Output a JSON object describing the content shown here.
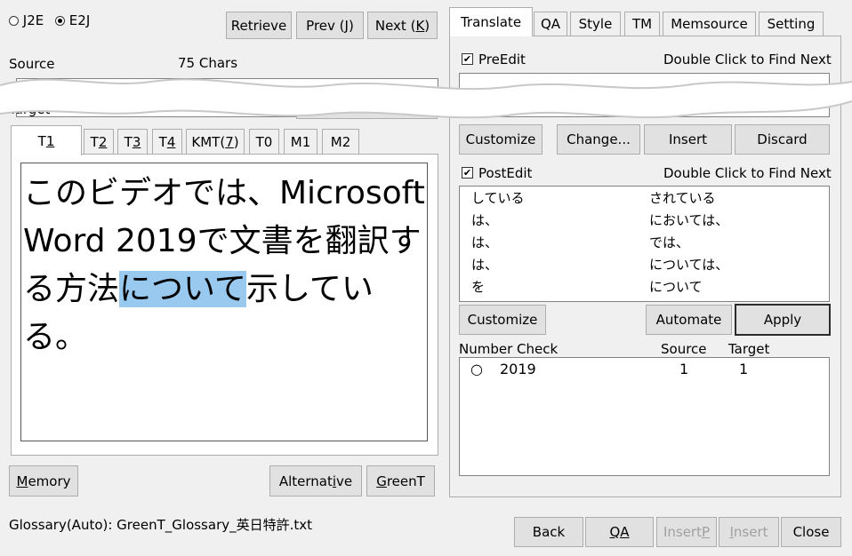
{
  "mode": {
    "options": [
      "J2E",
      "E2J"
    ],
    "selected": "E2J"
  },
  "nav_buttons": {
    "retrieve": "Retrieve",
    "prev_text": "Prev (",
    "prev_key": "J",
    "next_text": "Next (",
    "next_key": "K",
    "close_paren": ")"
  },
  "source": {
    "label": "Source",
    "chars": "75 Chars"
  },
  "target": {
    "label": "Target"
  },
  "left_tabs": [
    {
      "pre": "T",
      "key": "1",
      "post": ""
    },
    {
      "pre": "T",
      "key": "2",
      "post": ""
    },
    {
      "pre": "T",
      "key": "3",
      "post": ""
    },
    {
      "pre": "T",
      "key": "4",
      "post": ""
    },
    {
      "pre": "KMT(",
      "key": "7",
      "post": ")"
    },
    {
      "pre": "T0",
      "key": "",
      "post": ""
    },
    {
      "pre": "M1",
      "key": "",
      "post": ""
    },
    {
      "pre": "M2",
      "key": "",
      "post": ""
    }
  ],
  "editor": {
    "line1": "このビデオでは、Microsoft",
    "line2": "Word 2019で文書を翻訳す",
    "line3_before": "る方法",
    "line3_highlight": "について",
    "line3_after": "示している。"
  },
  "bottom_left": {
    "memory_key": "M",
    "memory_rest": "emory",
    "alt_pre": "Alternat",
    "alt_key": "i",
    "alt_post": "ve",
    "greent_key": "G",
    "greent_rest": "reenT"
  },
  "right_tabs": [
    "Translate",
    "QA",
    "Style",
    "TM",
    "Memsource",
    "Setting"
  ],
  "preedit": {
    "label": "PreEdit",
    "checked": "✔",
    "hint": "Double Click to Find Next"
  },
  "preedit_buttons": {
    "customize": "Customize",
    "change": "Change...",
    "insert": "Insert",
    "discard": "Discard"
  },
  "postedit": {
    "label": "PostEdit",
    "checked": "✔",
    "hint": "Double Click to Find Next",
    "rows": [
      {
        "from": "している",
        "to": "されている"
      },
      {
        "from": "は、",
        "to": "においては、"
      },
      {
        "from": "は、",
        "to": "では、"
      },
      {
        "from": "は、",
        "to": "については、"
      },
      {
        "from": "を",
        "to": "について"
      }
    ]
  },
  "postedit_buttons": {
    "customize": "Customize",
    "automate": "Automate",
    "apply": "Apply"
  },
  "number_check": {
    "label": "Number Check",
    "col_source": "Source",
    "col_target": "Target",
    "rows": [
      {
        "mark": "○",
        "number": "2019",
        "source": "1",
        "target": "1"
      }
    ]
  },
  "status": {
    "glossary": "Glossary(Auto): GreenT_Glossary_英日特許.txt"
  },
  "footer_buttons": {
    "back": "Back",
    "qa": "QA",
    "insertp_pre": "Insert",
    "insertp_key": "P",
    "insert_key": "I",
    "insert_rest": "nsert",
    "close": "Close"
  }
}
